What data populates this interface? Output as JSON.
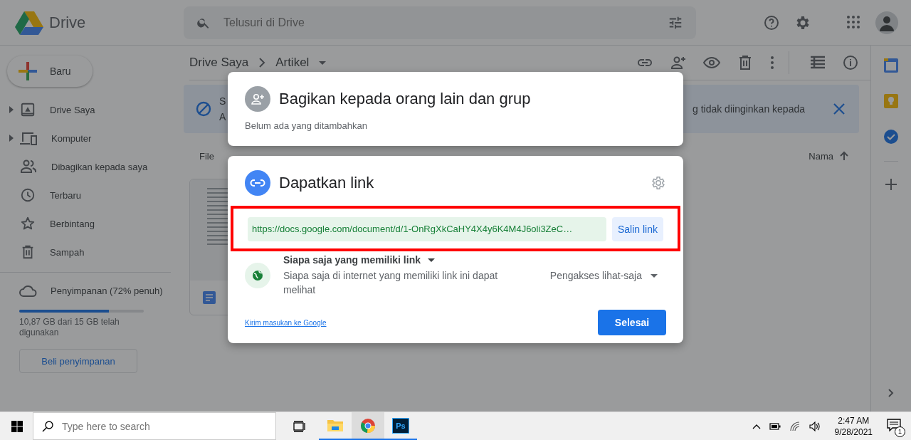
{
  "app": {
    "title": "Drive"
  },
  "search": {
    "placeholder": "Telusuri di Drive"
  },
  "new_button": {
    "label": "Baru"
  },
  "sidebar": {
    "items": [
      {
        "label": "Drive Saya",
        "kind": "drive",
        "expandable": true
      },
      {
        "label": "Komputer",
        "kind": "computer",
        "expandable": true
      },
      {
        "label": "Dibagikan kepada saya",
        "kind": "shared",
        "expandable": false
      },
      {
        "label": "Terbaru",
        "kind": "recent",
        "expandable": false
      },
      {
        "label": "Berbintang",
        "kind": "starred",
        "expandable": false
      },
      {
        "label": "Sampah",
        "kind": "trash",
        "expandable": false
      }
    ]
  },
  "storage": {
    "label": "Penyimpanan (72% penuh)",
    "level": 0.72,
    "usage": "10,87 GB dari 15 GB telah digunakan",
    "button": "Beli penyimpanan"
  },
  "breadcrumb": [
    "Drive Saya",
    "Artikel"
  ],
  "banner": {
    "texts": [
      "S",
      "A",
      "g tidak diinginkan kepada"
    ]
  },
  "file_list": {
    "column_1": "File",
    "sort_column": "Nama"
  },
  "share_dialog": {
    "title": "Bagikan kepada orang lain dan grup",
    "subtitle": "Belum ada yang ditambahkan"
  },
  "link_dialog": {
    "title": "Dapatkan link",
    "url": "https://docs.google.com/document/d/1-OnRgXkCaHY4X4y6K4M4J6oli3ZeC…",
    "copy_button": "Salin link",
    "highlighted": true,
    "access_scope": "Siapa saja yang memiliki link",
    "access_description": "Siapa saja di internet yang memiliki link ini dapat melihat",
    "role": "Pengakses lihat-saja",
    "feedback_link": "Kirim masukan ke Google",
    "done_button": "Selesai"
  },
  "taskbar": {
    "search_placeholder": "Type here to search",
    "apps": [
      {
        "kind": "files",
        "selected": false
      },
      {
        "kind": "browser",
        "selected": true
      },
      {
        "kind": "editor",
        "label": "Ps",
        "selected": false
      }
    ],
    "time": "2:47 AM",
    "date": "9/28/2021",
    "notification_count": "1"
  }
}
